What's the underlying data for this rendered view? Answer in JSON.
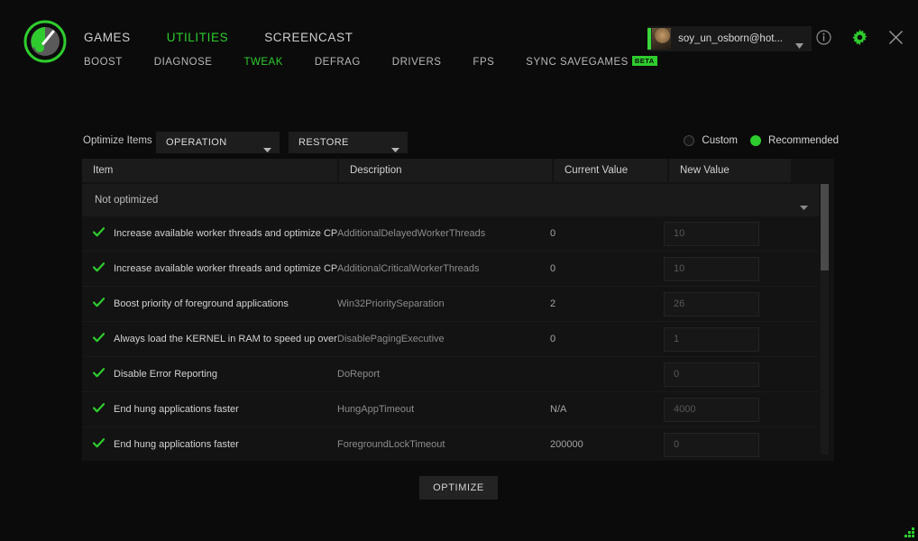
{
  "window": {
    "logo_icon": "gauge-logo-icon",
    "accent_color": "#2ecc2e"
  },
  "nav": {
    "primary": [
      {
        "label": "GAMES",
        "active": false
      },
      {
        "label": "UTILITIES",
        "active": true
      },
      {
        "label": "SCREENCAST",
        "active": false
      }
    ],
    "secondary": [
      {
        "label": "BOOST",
        "active": false,
        "badge": ""
      },
      {
        "label": "DIAGNOSE",
        "active": false,
        "badge": ""
      },
      {
        "label": "TWEAK",
        "active": true,
        "badge": ""
      },
      {
        "label": "DEFRAG",
        "active": false,
        "badge": ""
      },
      {
        "label": "DRIVERS",
        "active": false,
        "badge": ""
      },
      {
        "label": "FPS",
        "active": false,
        "badge": ""
      },
      {
        "label": "SYNC SAVEGAMES",
        "active": false,
        "badge": "BETA"
      }
    ]
  },
  "account": {
    "name": "soy_un_osborn@hot...",
    "avatar_icon": "user-avatar",
    "caret_icon": "chevron-down-icon"
  },
  "header_icons": [
    {
      "name": "info-icon"
    },
    {
      "name": "gear-icon"
    },
    {
      "name": "close-icon"
    }
  ],
  "toolbar": {
    "label": "Optimize Items",
    "operation_select": {
      "value": "OPERATION",
      "caret_icon": "chevron-down-icon"
    },
    "restore_select": {
      "value": "RESTORE",
      "caret_icon": "chevron-down-icon"
    },
    "modes": [
      {
        "label": "Custom",
        "selected": false
      },
      {
        "label": "Recommended",
        "selected": true
      }
    ]
  },
  "table": {
    "columns": [
      {
        "label": "Item"
      },
      {
        "label": "Description"
      },
      {
        "label": "Current Value"
      },
      {
        "label": "New Value"
      }
    ],
    "group": {
      "label": "Not optimized",
      "caret_icon": "chevron-down-icon"
    },
    "rows": [
      {
        "checked": true,
        "item": "Increase available worker threads and optimize CPU capability",
        "description": "AdditionalDelayedWorkerThreads",
        "current_value": "0",
        "new_value": "10"
      },
      {
        "checked": true,
        "item": "Increase available worker threads and optimize CPU capability",
        "description": "AdditionalCriticalWorkerThreads",
        "current_value": "0",
        "new_value": "10"
      },
      {
        "checked": true,
        "item": "Boost priority of foreground applications",
        "description": "Win32PrioritySeparation",
        "current_value": "2",
        "new_value": "26"
      },
      {
        "checked": true,
        "item": "Always load the KERNEL in RAM to speed up overall system performance",
        "description": "DisablePagingExecutive",
        "current_value": "0",
        "new_value": "1"
      },
      {
        "checked": true,
        "item": "Disable Error Reporting",
        "description": "DoReport",
        "current_value": "",
        "new_value": "0"
      },
      {
        "checked": true,
        "item": "End hung applications faster",
        "description": "HungAppTimeout",
        "current_value": "N/A",
        "new_value": "4000"
      },
      {
        "checked": true,
        "item": "End hung applications faster",
        "description": "ForegroundLockTimeout",
        "current_value": "200000",
        "new_value": "0"
      }
    ]
  },
  "footer": {
    "optimize_label": "OPTIMIZE"
  }
}
